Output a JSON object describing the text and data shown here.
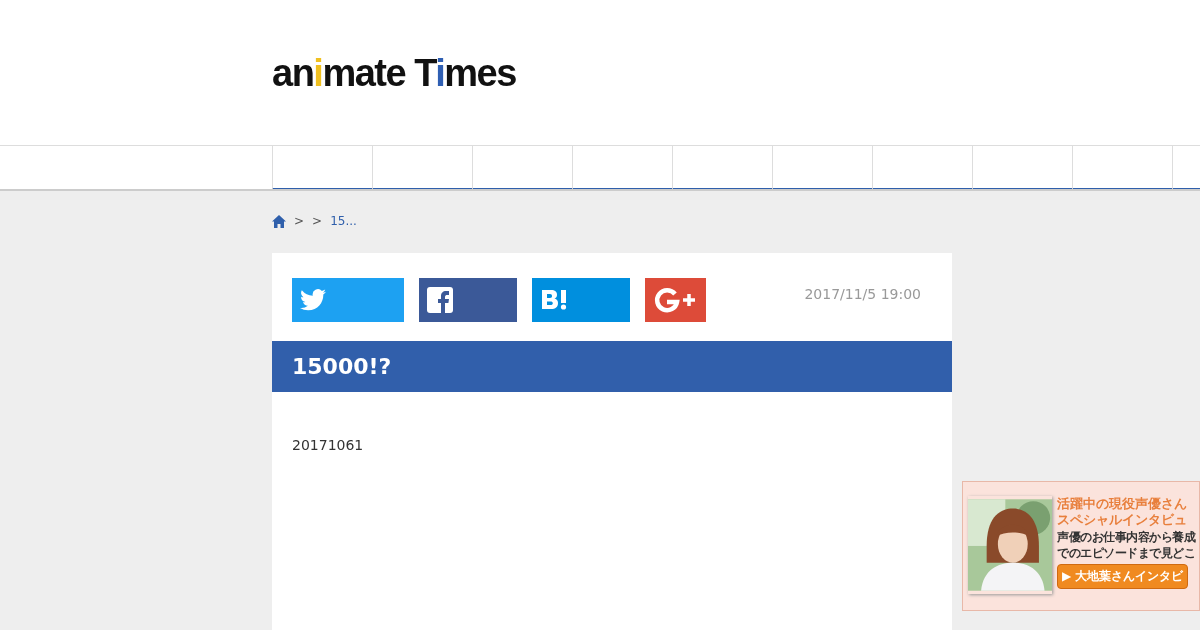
{
  "logo": [
    {
      "text": "an"
    },
    {
      "text": "i",
      "color": "#f0c020"
    },
    {
      "text": "mate T"
    },
    {
      "text": "i",
      "color": "#2f5fb3"
    },
    {
      "text": "mes"
    }
  ],
  "breadcrumb": {
    "separators": [
      ">",
      ">"
    ],
    "current": "15..."
  },
  "share_buttons": [
    {
      "kind": "twitter"
    },
    {
      "kind": "facebook"
    },
    {
      "kind": "hatena"
    },
    {
      "kind": "google"
    }
  ],
  "date": "2017/11/5 19:00",
  "article": {
    "title": "15000!?",
    "body": "20171061"
  },
  "banner": {
    "headline": [
      "活躍中の現役声優さん",
      "スペシャルインタビュ"
    ],
    "text": [
      "声優のお仕事内容から養成",
      "でのエピソードまで見どこ"
    ],
    "button": "▶ 大地葉さんインタビ"
  }
}
